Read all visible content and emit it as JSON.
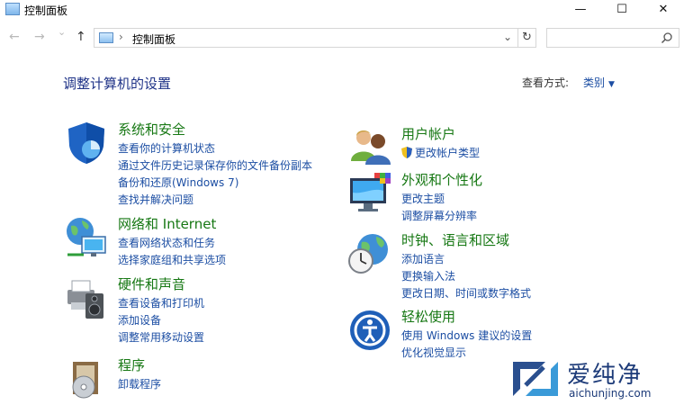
{
  "window": {
    "title": "控制面板",
    "min": "—",
    "max": "☐",
    "close": "✕"
  },
  "nav": {
    "back": "←",
    "forward": "→",
    "recent": "⌄",
    "up": "↑"
  },
  "address": {
    "separator": "›",
    "path": "控制面板",
    "dropdown": "⌄",
    "refresh": "↻"
  },
  "search": {
    "placeholder": ""
  },
  "page": {
    "title": "调整计算机的设置",
    "view_by_label": "查看方式:",
    "view_by_value": "类别"
  },
  "categories": {
    "system": {
      "title": "系统和安全",
      "links": [
        "查看你的计算机状态",
        "通过文件历史记录保存你的文件备份副本",
        "备份和还原(Windows 7)",
        "查找并解决问题"
      ]
    },
    "network": {
      "title": "网络和 Internet",
      "links": [
        "查看网络状态和任务",
        "选择家庭组和共享选项"
      ]
    },
    "hardware": {
      "title": "硬件和声音",
      "links": [
        "查看设备和打印机",
        "添加设备",
        "调整常用移动设置"
      ]
    },
    "programs": {
      "title": "程序",
      "links": [
        "卸载程序"
      ]
    },
    "user": {
      "title": "用户帐户",
      "links": [
        "更改帐户类型"
      ]
    },
    "appearance": {
      "title": "外观和个性化",
      "links": [
        "更改主题",
        "调整屏幕分辨率"
      ]
    },
    "clock": {
      "title": "时钟、语言和区域",
      "links": [
        "添加语言",
        "更换输入法",
        "更改日期、时间或数字格式"
      ]
    },
    "ease": {
      "title": "轻松使用",
      "links": [
        "使用 Windows 建议的设置",
        "优化视觉显示"
      ]
    }
  },
  "watermark": {
    "name": "爱纯净",
    "url": "aichunjing.com"
  },
  "colors": {
    "category_title": "#177814",
    "link": "#1c4ea3",
    "page_title": "#1e3287"
  },
  "icons": {
    "system": "shield-icon",
    "network": "network-globe-icon",
    "hardware": "printer-speaker-icon",
    "programs": "programs-box-icon",
    "user": "users-icon",
    "appearance": "monitor-palette-icon",
    "clock": "clock-globe-icon",
    "ease": "ease-of-access-icon"
  }
}
